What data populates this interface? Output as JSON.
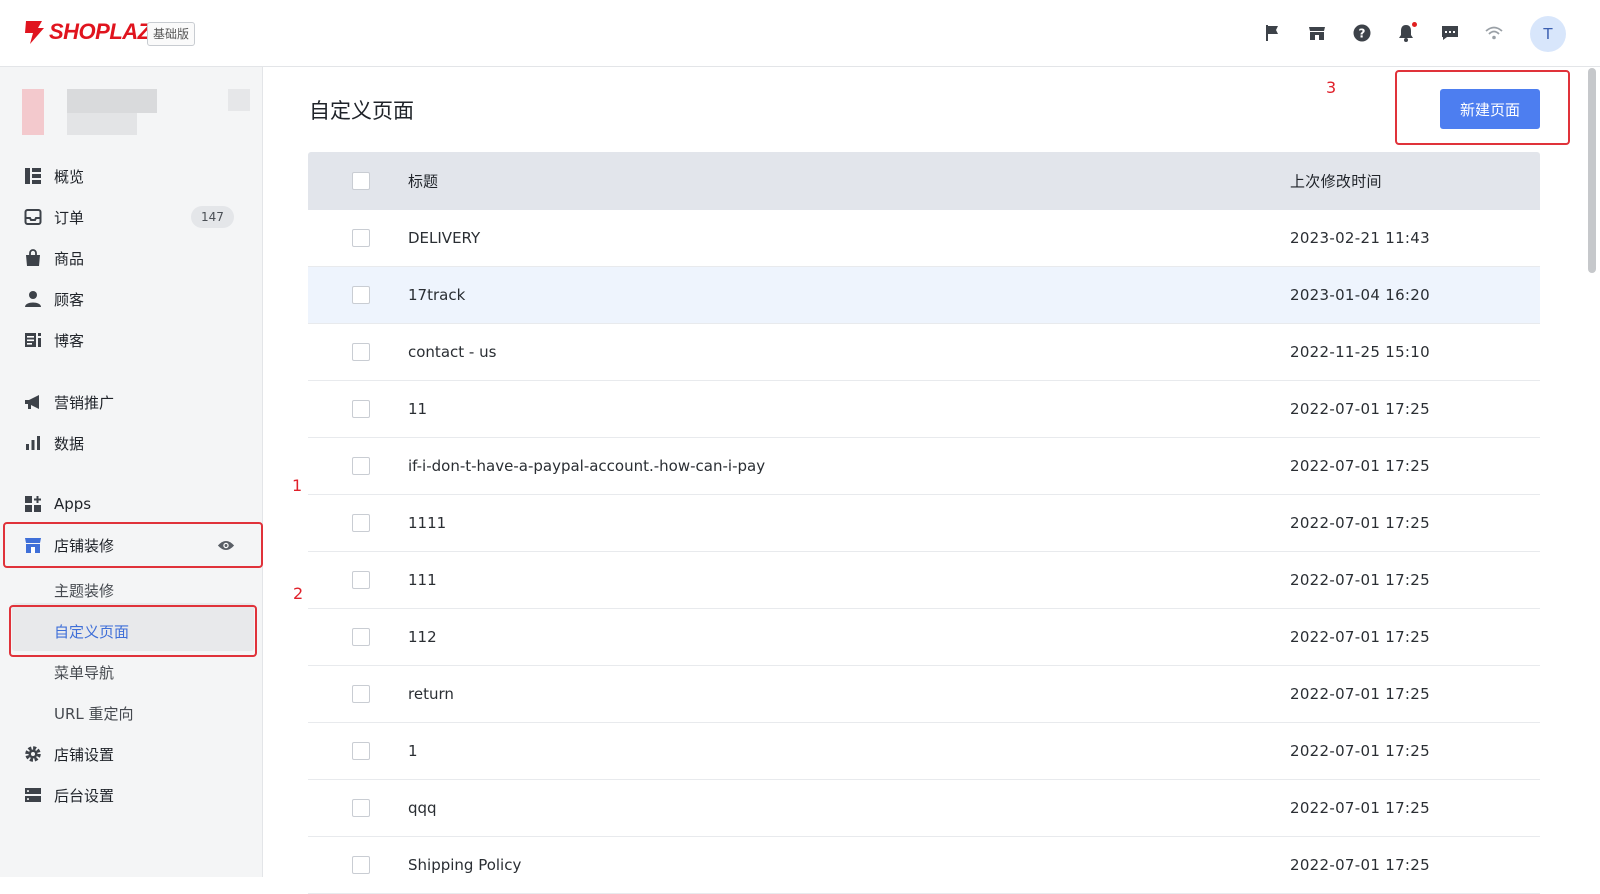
{
  "header": {
    "brand": "SHOPLAZZA",
    "edition": "基础版",
    "avatar_letter": "T",
    "icons": [
      "flag-icon",
      "store-icon",
      "help-icon",
      "bell-icon",
      "message-icon",
      "wifi-icon"
    ],
    "brand_color": "#e0141e"
  },
  "sidebar": {
    "nav": [
      {
        "label": "概览",
        "icon": "overview-icon"
      },
      {
        "label": "订单",
        "icon": "inbox-icon",
        "badge": "147"
      },
      {
        "label": "商品",
        "icon": "bag-icon"
      },
      {
        "label": "顾客",
        "icon": "person-icon"
      },
      {
        "label": "博客",
        "icon": "blog-icon"
      },
      {
        "label": "营销推广",
        "icon": "megaphone-icon"
      },
      {
        "label": "数据",
        "icon": "bar-chart-icon"
      },
      {
        "label": "Apps",
        "icon": "apps-icon"
      },
      {
        "label": "店铺装修",
        "icon": "storefront-icon"
      },
      {
        "label": "店铺设置",
        "icon": "gear-icon"
      },
      {
        "label": "后台设置",
        "icon": "server-icon"
      }
    ],
    "sub": [
      {
        "label": "主题装修"
      },
      {
        "label": "自定义页面"
      },
      {
        "label": "菜单导航"
      },
      {
        "label": "URL 重定向"
      }
    ],
    "accent_color": "#3f6fd8"
  },
  "annotations": {
    "a1": "1",
    "a2": "2",
    "a3": "3"
  },
  "main": {
    "title": "自定义页面",
    "new_button": "新建页面",
    "columns": {
      "title": "标题",
      "time": "上次修改时间"
    },
    "rows": [
      {
        "title": "DELIVERY",
        "time": "2023-02-21 11:43"
      },
      {
        "title": "17track",
        "time": "2023-01-04 16:20"
      },
      {
        "title": "contact - us",
        "time": "2022-11-25 15:10"
      },
      {
        "title": "11",
        "time": "2022-07-01 17:25"
      },
      {
        "title": "if-i-don-t-have-a-paypal-account.-how-can-i-pay",
        "time": "2022-07-01 17:25"
      },
      {
        "title": "1111",
        "time": "2022-07-01 17:25"
      },
      {
        "title": "111",
        "time": "2022-07-01 17:25"
      },
      {
        "title": "112",
        "time": "2022-07-01 17:25"
      },
      {
        "title": "return",
        "time": "2022-07-01 17:25"
      },
      {
        "title": "1",
        "time": "2022-07-01 17:25"
      },
      {
        "title": "qqq",
        "time": "2022-07-01 17:25"
      },
      {
        "title": "Shipping Policy",
        "time": "2022-07-01 17:25"
      }
    ],
    "button_color": "#4d7ef0",
    "highlight_color": "#e0323a"
  }
}
